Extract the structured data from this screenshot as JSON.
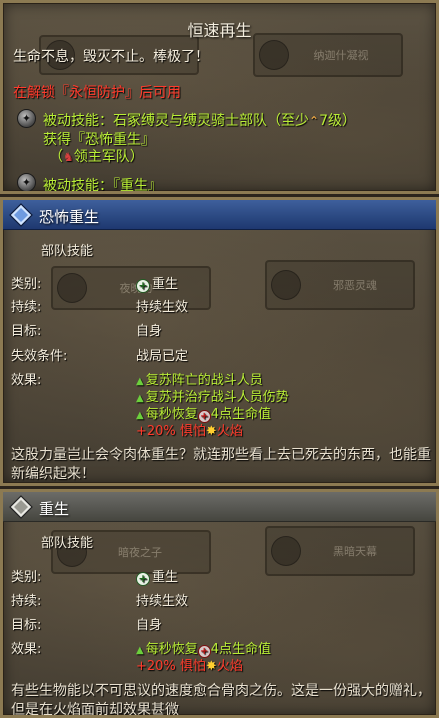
{
  "panel1": {
    "title": "恒速再生",
    "description": "生命不息，毁灭不止。棒极了！",
    "unlock": "在解锁『永恒防护』后可用",
    "passive1_line1_prefix": "被动技能：石冢缚灵与缚灵骑士部队（至少",
    "passive1_level_icon": "chevron-up-icon",
    "passive1_line1_suffix": "7级）",
    "passive1_line2": "获得『恐怖重生』",
    "passive1_line3_prefix": "（",
    "passive1_line3_icon": "lord-crown-icon",
    "passive1_line3_suffix": "领主军队）",
    "passive2": "被动技能：『重生』",
    "ghost_buttons": [
      "",
      "纳迦什凝视"
    ]
  },
  "panel2": {
    "header": "恐怖重生",
    "subheader": "部队技能",
    "rows": {
      "category_label": "类别:",
      "category_value": "重生",
      "duration_label": "持续:",
      "duration_value": "持续生效",
      "target_label": "目标:",
      "target_value": "自身",
      "expire_label": "失效条件:",
      "expire_value": "战局已定",
      "effects_label": "效果:"
    },
    "effects": {
      "e1": "复苏阵亡的战斗人员",
      "e2": "复苏并治疗战斗人员伤势",
      "e3_prefix": "每秒恢复",
      "e3_suffix": "4点生命值",
      "e4_prefix": "+20% 惧怕",
      "e4_suffix": "火焰"
    },
    "flavor": "这股力量岂止会令肉体重生？就连那些看上去已死去的东西，也能重新编织起来！",
    "ghost_buttons": [
      "夜晚的",
      "邪恶灵魂"
    ]
  },
  "panel3": {
    "header": "重生",
    "subheader": "部队技能",
    "rows": {
      "category_label": "类别:",
      "category_value": "重生",
      "duration_label": "持续:",
      "duration_value": "持续生效",
      "target_label": "目标:",
      "target_value": "自身",
      "effects_label": "效果:"
    },
    "effects": {
      "e1_prefix": "每秒恢复",
      "e1_suffix": "4点生命值",
      "e2_prefix": "+20% 惧怕",
      "e2_suffix": "火焰"
    },
    "flavor": "有些生物能以不可思议的速度愈合骨肉之伤。这是一份强大的赠礼，但是在火焰面前却效果甚微",
    "ghost_buttons": [
      "暗夜之子",
      "黑暗天幕"
    ]
  },
  "colors": {
    "accent_blue": "#2c4a83",
    "green_text": "#b9ee36",
    "red_text": "#ff3b2c",
    "frame_gold": "#8c7a52"
  }
}
